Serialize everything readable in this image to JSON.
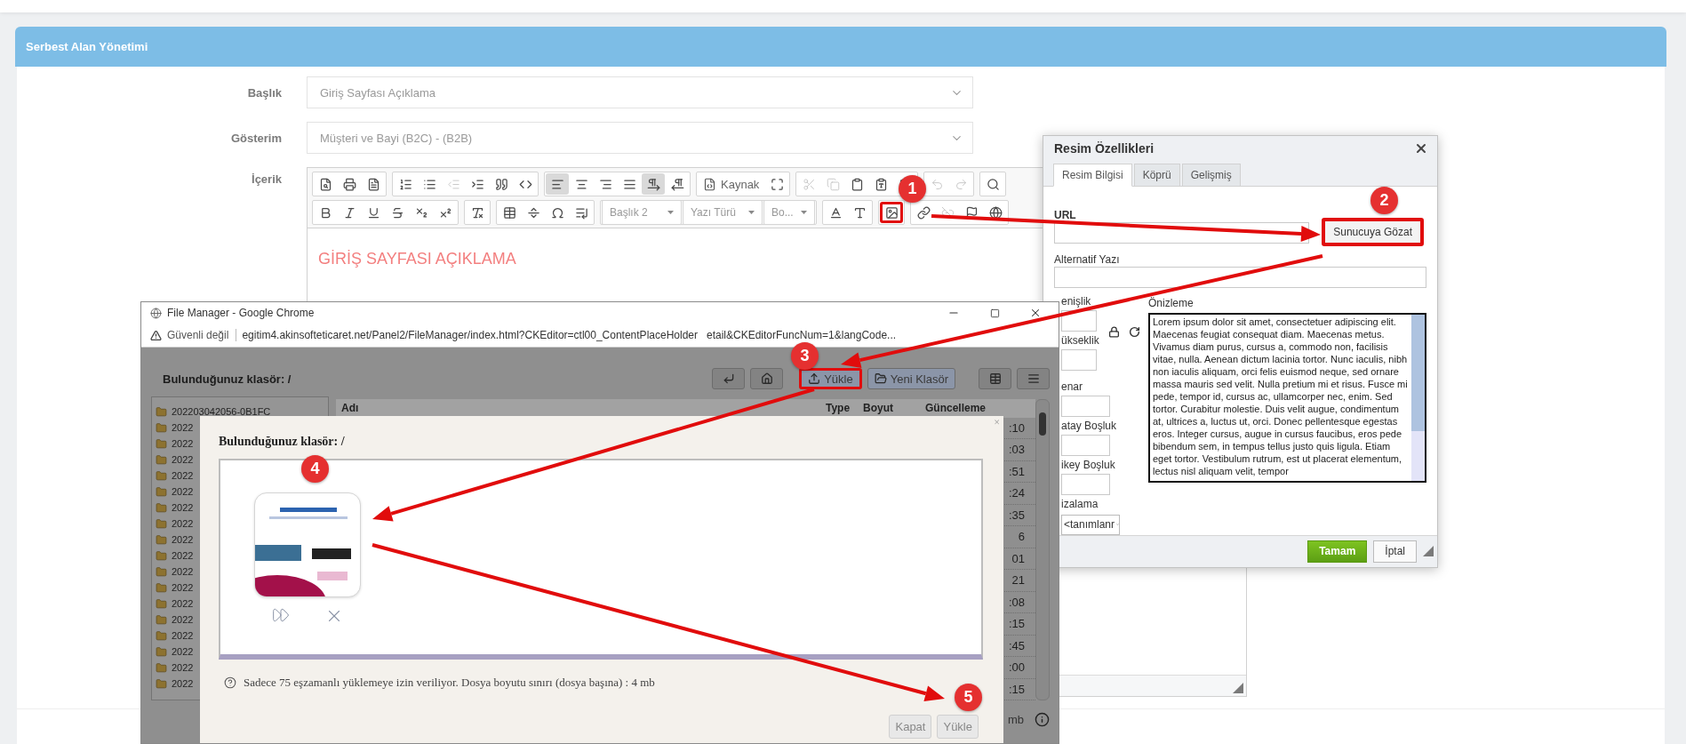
{
  "panel": {
    "title": "Serbest Alan Yönetimi"
  },
  "form": {
    "fields": [
      {
        "kind": "select",
        "label": "Başlık",
        "value": "Giriş Sayfası Açıklama"
      },
      {
        "kind": "select",
        "label": "Gösterim",
        "value": "Müşteri ve Bayi (B2C) - (B2B)"
      },
      {
        "kind": "editor",
        "label": "İçerik"
      }
    ]
  },
  "editor": {
    "content": "GİRİŞ SAYFASI AÇIKLAMA",
    "toolbar_rows": [
      [
        [
          {
            "kind": "button",
            "selected": false,
            "disabled": false
          },
          {
            "kind": "button",
            "selected": false,
            "disabled": false
          },
          {
            "kind": "button",
            "selected": false,
            "disabled": false
          }
        ],
        [
          {
            "kind": "button",
            "selected": false,
            "disabled": false
          },
          {
            "kind": "button",
            "selected": false,
            "disabled": false
          },
          {
            "kind": "button",
            "selected": false,
            "disabled": true
          },
          {
            "kind": "button",
            "selected": false,
            "disabled": false
          },
          {
            "kind": "button",
            "selected": false,
            "disabled": false
          },
          {
            "kind": "button",
            "selected": false,
            "disabled": false
          }
        ],
        [
          {
            "kind": "button",
            "selected": true,
            "disabled": false
          },
          {
            "kind": "button",
            "selected": false,
            "disabled": false
          },
          {
            "kind": "button",
            "selected": false,
            "disabled": false
          },
          {
            "kind": "button",
            "selected": false,
            "disabled": false
          },
          {
            "kind": "button",
            "selected": true,
            "disabled": false
          },
          {
            "kind": "button",
            "selected": false,
            "disabled": false
          }
        ],
        [
          {
            "kind": "labeled",
            "label": "Kaynak"
          },
          {
            "kind": "button",
            "selected": false,
            "disabled": false
          }
        ],
        [
          {
            "kind": "button",
            "selected": false,
            "disabled": true
          },
          {
            "kind": "button",
            "selected": false,
            "disabled": true
          },
          {
            "kind": "button",
            "selected": false,
            "disabled": false
          },
          {
            "kind": "button",
            "selected": false,
            "disabled": false
          },
          {
            "kind": "button",
            "selected": false,
            "disabled": false
          }
        ],
        [
          {
            "kind": "button",
            "selected": false,
            "disabled": true
          },
          {
            "kind": "button",
            "selected": false,
            "disabled": true
          }
        ],
        [
          {
            "kind": "button",
            "selected": false,
            "disabled": false
          }
        ]
      ],
      [
        [
          {
            "kind": "button",
            "selected": false,
            "disabled": false
          },
          {
            "kind": "button",
            "selected": false,
            "disabled": false
          },
          {
            "kind": "button",
            "selected": false,
            "disabled": false
          },
          {
            "kind": "button",
            "selected": false,
            "disabled": false
          },
          {
            "kind": "button",
            "selected": false,
            "disabled": false
          },
          {
            "kind": "button",
            "selected": false,
            "disabled": false
          }
        ],
        [
          {
            "kind": "button",
            "selected": false,
            "disabled": false
          }
        ],
        [
          {
            "kind": "button",
            "selected": false,
            "disabled": false
          },
          {
            "kind": "button",
            "selected": false,
            "disabled": false
          },
          {
            "kind": "button",
            "selected": false,
            "disabled": false
          },
          {
            "kind": "button",
            "selected": false,
            "disabled": false
          }
        ],
        [
          {
            "kind": "combo",
            "label": "Başlık 2"
          },
          {
            "kind": "combo",
            "label": "Yazı Türü"
          },
          {
            "kind": "combo",
            "label": "Bo..."
          }
        ],
        [
          {
            "kind": "button",
            "selected": false,
            "disabled": false
          },
          {
            "kind": "button",
            "selected": false,
            "disabled": false
          }
        ],
        [
          {
            "kind": "button",
            "selected": false,
            "disabled": false,
            "highlighted": true
          }
        ],
        [
          {
            "kind": "button",
            "selected": false,
            "disabled": false
          },
          {
            "kind": "button",
            "selected": false,
            "disabled": true
          },
          {
            "kind": "button",
            "selected": false,
            "disabled": false
          },
          {
            "kind": "button",
            "selected": false,
            "disabled": false
          }
        ]
      ]
    ]
  },
  "image_dialog": {
    "title": "Resim Özellikleri",
    "tabs": [
      {
        "label": "Resim Bilgisi",
        "selected": true
      },
      {
        "label": "Köprü",
        "selected": false
      },
      {
        "label": "Gelişmiş",
        "selected": false
      }
    ],
    "url_label": "URL",
    "browse_button": {
      "label": "Sunucuya Gözat",
      "highlighted": true
    },
    "alt_label": "Alternatif Yazı",
    "size_fields": [
      "enişlik",
      "ükseklik"
    ],
    "spacing_fields": [
      "enar",
      "atay Boşluk",
      "ikey Boşluk"
    ],
    "align_label": "izalama",
    "align_value": "<tanımlanr",
    "preview_label": "Önizleme",
    "preview_text": "Lorem ipsum dolor sit amet, consectetuer adipiscing elit. Maecenas feugiat consequat diam. Maecenas metus. Vivamus diam purus, cursus a, commodo non, facilisis vitae, nulla. Aenean dictum lacinia tortor. Nunc iaculis, nibh non iaculis aliquam, orci felis euismod neque, sed ornare massa mauris sed velit. Nulla pretium mi et risus. Fusce mi pede, tempor id, cursus ac, ullamcorper nec, enim. Sed tortor. Curabitur molestie. Duis velit augue, condimentum at, ultrices a, luctus ut, orci. Donec pellentesque egestas eros. Integer cursus, augue in cursus faucibus, eros pede bibendum sem, in tempus tellus justo quis ligula. Etiam eget tortor. Vestibulum rutrum, est ut placerat elementum, lectus nisl aliquam velit, tempor",
    "buttons": [
      {
        "kind": "primary",
        "label": "Tamam"
      },
      {
        "kind": "secondary",
        "label": "İptal"
      }
    ]
  },
  "file_manager": {
    "window_title": "File Manager - Google Chrome",
    "security": "Güvenli değil",
    "url_start": "egitim4.akinsofteticaret.net/Panel2/FileManager/index.html?CKEditor=ctl00_ContentPlaceHolder",
    "url_end": "etail&CKEditorFuncNum=1&langCode...",
    "folder_label": "Bulunduğunuz klasör: /",
    "buttons": [
      {
        "kind": "back"
      },
      {
        "kind": "home"
      },
      {
        "kind": "upload",
        "label": "Yükle",
        "highlighted": true
      },
      {
        "kind": "new_folder",
        "label": "Yeni Klasör"
      },
      {
        "kind": "grid"
      },
      {
        "kind": "list"
      }
    ],
    "folders": [
      "202203042056-0B1FC",
      "2022",
      "2022",
      "2022",
      "2022",
      "2022",
      "2022",
      "2022",
      "2022",
      "2022",
      "2022",
      "2022",
      "2022",
      "2022",
      "2022",
      "2022",
      "2022",
      "2022"
    ],
    "columns": [
      "Adı",
      "Type",
      "Boyut",
      "Güncelleme"
    ],
    "times": [
      ":10",
      ":03",
      ":51",
      ":24",
      ":35",
      "6",
      "01",
      "21",
      ":08",
      ":15",
      ":45",
      ":00",
      ":15"
    ],
    "footer_text": "mb"
  },
  "upload_modal": {
    "close": "×",
    "title": "Bulunduğunuz klasör: /",
    "info": "Sadece 75 eşzamanlı yüklemeye izin veriliyor. Dosya boyutu sınırı (dosya başına) : 4 mb",
    "buttons": [
      "Kapat",
      "Yükle"
    ]
  },
  "annotations": [
    "1",
    "2",
    "3",
    "4",
    "5"
  ]
}
